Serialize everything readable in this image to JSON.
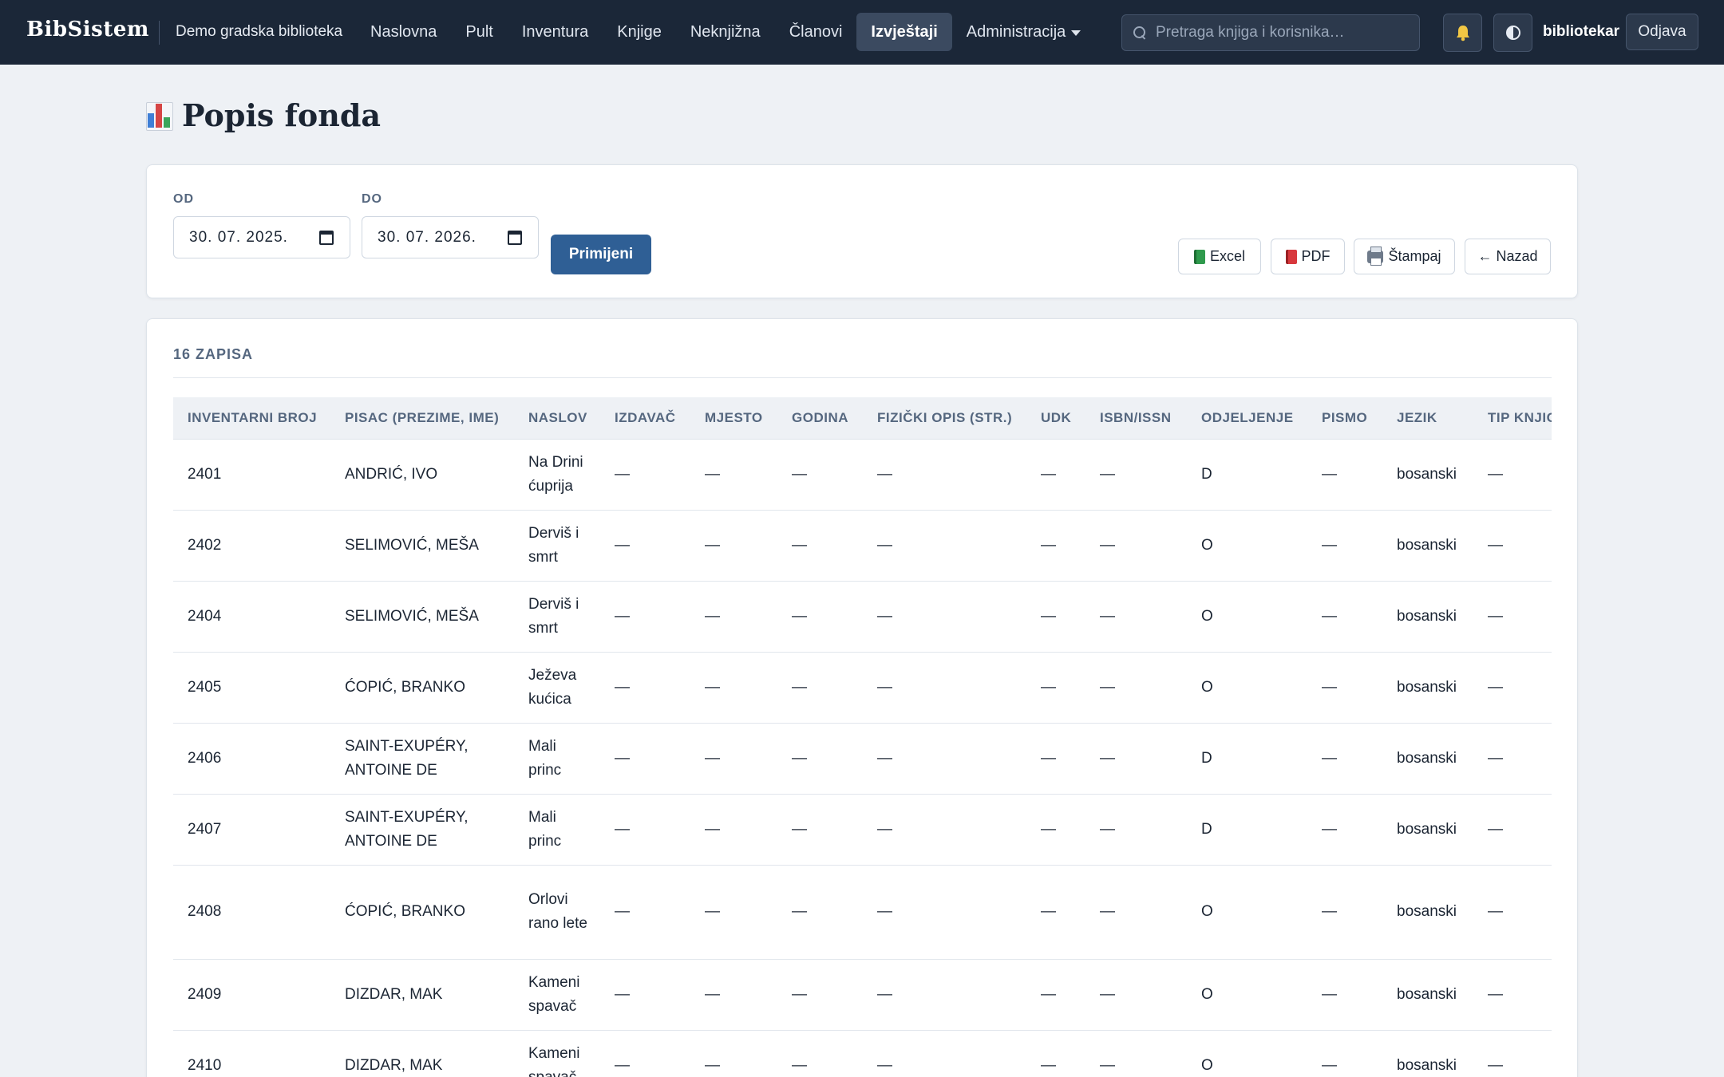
{
  "app": {
    "brand": "BibSistem",
    "library_name": "Demo gradska biblioteka",
    "nav": [
      {
        "label": "Naslovna"
      },
      {
        "label": "Pult"
      },
      {
        "label": "Inventura"
      },
      {
        "label": "Knjige"
      },
      {
        "label": "Neknjižna"
      },
      {
        "label": "Članovi"
      },
      {
        "label": "Izvještaji",
        "active": true
      },
      {
        "label": "Administracija",
        "dropdown": true
      }
    ],
    "search_placeholder": "Pretraga knjiga i korisnika…",
    "username": "bibliotekar",
    "logout_label": "Odjava",
    "colors": {
      "nav_bg": "#1b2738",
      "primary": "#2f5f95",
      "page_bg": "#eef1f5"
    },
    "icons": {
      "search": "search-icon",
      "bell": "bell-icon",
      "theme": "theme-toggle-icon"
    }
  },
  "page": {
    "title": "Popis fonda",
    "title_icon": "bar-chart-icon"
  },
  "filters": {
    "from_label": "OD",
    "from_value": "30. 07. 2025.",
    "to_label": "DO",
    "to_value": "30. 07. 2026.",
    "apply_label": "Primijeni",
    "actions": [
      {
        "label": "Excel",
        "icon": "excel-book-icon"
      },
      {
        "label": "PDF",
        "icon": "pdf-book-icon"
      },
      {
        "label": "Štampaj",
        "icon": "printer-icon"
      },
      {
        "label": "← Nazad",
        "icon": "none"
      }
    ]
  },
  "table": {
    "record_count": "16 ZAPISA",
    "columns": [
      "INVENTARNI BROJ",
      "PISAC (PREZIME, IME)",
      "NASLOV",
      "IZDAVAČ",
      "MJESTO",
      "GODINA",
      "FIZIČKI OPIS (STR.)",
      "UDK",
      "ISBN/ISSN",
      "ODJELJENJE",
      "PISMO",
      "JEZIK",
      "TIP KNJIGE"
    ],
    "rows": [
      [
        "2401",
        "ANDRIĆ, IVO",
        "Na Drini ćuprija",
        "—",
        "—",
        "—",
        "—",
        "—",
        "—",
        "D",
        "—",
        "bosanski",
        "—"
      ],
      [
        "2402",
        "SELIMOVIĆ, MEŠA",
        "Derviš i smrt",
        "—",
        "—",
        "—",
        "—",
        "—",
        "—",
        "O",
        "—",
        "bosanski",
        "—"
      ],
      [
        "2404",
        "SELIMOVIĆ, MEŠA",
        "Derviš i smrt",
        "—",
        "—",
        "—",
        "—",
        "—",
        "—",
        "O",
        "—",
        "bosanski",
        "—"
      ],
      [
        "2405",
        "ĆOPIĆ, BRANKO",
        "Ježeva kućica",
        "—",
        "—",
        "—",
        "—",
        "—",
        "—",
        "O",
        "—",
        "bosanski",
        "—"
      ],
      [
        "2406",
        "SAINT-EXUPÉRY, ANTOINE DE",
        "Mali princ",
        "—",
        "—",
        "—",
        "—",
        "—",
        "—",
        "D",
        "—",
        "bosanski",
        "—"
      ],
      [
        "2407",
        "SAINT-EXUPÉRY, ANTOINE DE",
        "Mali princ",
        "—",
        "—",
        "—",
        "—",
        "—",
        "—",
        "D",
        "—",
        "bosanski",
        "—"
      ],
      [
        "2408",
        "ĆOPIĆ, BRANKO",
        "Orlovi rano lete",
        "—",
        "—",
        "—",
        "—",
        "—",
        "—",
        "O",
        "—",
        "bosanski",
        "—"
      ],
      [
        "2409",
        "DIZDAR, MAK",
        "Kameni spavač",
        "—",
        "—",
        "—",
        "—",
        "—",
        "—",
        "O",
        "—",
        "bosanski",
        "—"
      ],
      [
        "2410",
        "DIZDAR, MAK",
        "Kameni spavač",
        "—",
        "—",
        "—",
        "—",
        "—",
        "—",
        "O",
        "—",
        "bosanski",
        "—"
      ]
    ]
  }
}
